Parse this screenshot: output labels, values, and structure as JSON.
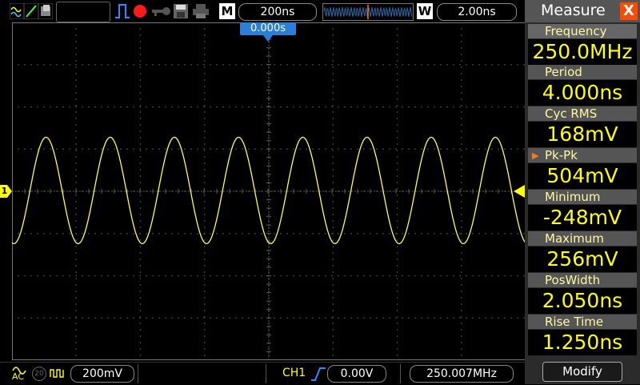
{
  "toolbar": {
    "mode_badge": "M",
    "timebase": "200ns",
    "window_badge": "W",
    "window_value": "2.00ns"
  },
  "trigger_time": "0.000s",
  "channel_marker": "1",
  "bottom": {
    "coupling": "AC",
    "bw_limit": "20",
    "volts_div": "200mV",
    "trigger_source": "CH1",
    "trigger_level": "0.00V",
    "frequency_counter": "250.007MHz"
  },
  "panel": {
    "title": "Measure",
    "close_label": "X",
    "modify_label": "Modify",
    "measurements": [
      {
        "label": "Frequency",
        "value": "250.0MHz"
      },
      {
        "label": "Period",
        "value": "4.000ns"
      },
      {
        "label": "Cyc RMS",
        "value": "168mV"
      },
      {
        "label": "Pk-Pk",
        "value": "504mV",
        "selected": true
      },
      {
        "label": "Minimum",
        "value": "-248mV"
      },
      {
        "label": "Maximum",
        "value": "256mV"
      },
      {
        "label": "PosWidth",
        "value": "2.050ns"
      },
      {
        "label": "Rise Time",
        "value": "1.250ns"
      }
    ]
  },
  "colors": {
    "trace": "#ffff44",
    "grid": "#5a5a5a",
    "accent": "#ff7a1a",
    "value_text": "#ffff00"
  },
  "waveform": {
    "cycles_visible": 8,
    "max_mV": 256,
    "min_mV": -248,
    "volts_per_div_mV": 200
  }
}
